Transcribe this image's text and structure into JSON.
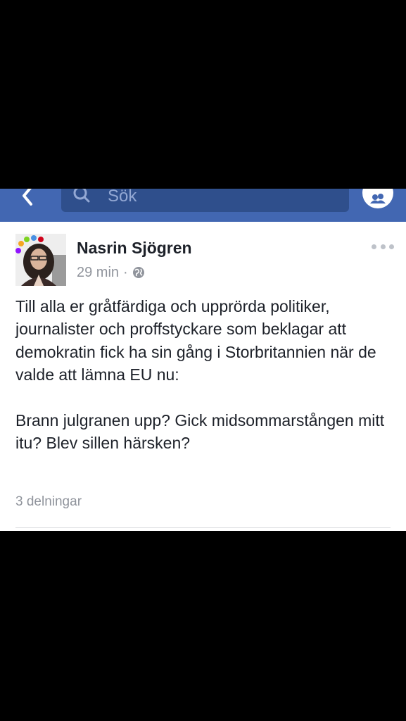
{
  "navbar": {
    "back_icon": "chevron-left-icon",
    "search_placeholder": "Sök",
    "search_icon": "search-icon",
    "friends_icon": "friends-icon",
    "color": "#4267b2"
  },
  "post": {
    "author": "Nasrin Sjögren",
    "time": "29 min",
    "separator": "·",
    "privacy_icon": "globe-icon",
    "more_icon": "more-dots-icon",
    "paragraphs": [
      "Till alla er gråtfärdiga och upprörda politiker, journalister och proffstyckare som beklagar att demokratin fick ha sin gång i Storbritannien när de valde att lämna EU nu:",
      "Brann julgranen upp? Gick midsommarstången mitt itu? Blev sillen härsken?"
    ],
    "shares": "3 delningar"
  }
}
